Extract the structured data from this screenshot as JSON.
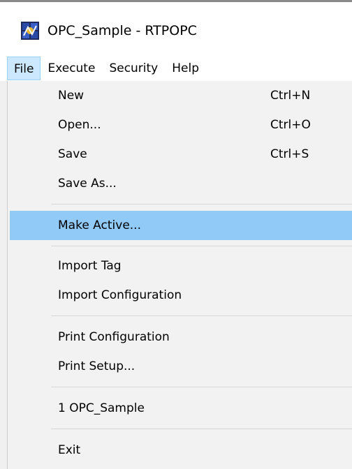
{
  "window": {
    "title": "OPC_Sample - RTPOPC",
    "icon": "rtpopc-app-icon"
  },
  "menu_bar": [
    {
      "label": "File",
      "open": true
    },
    {
      "label": "Execute",
      "open": false
    },
    {
      "label": "Security",
      "open": false
    },
    {
      "label": "Help",
      "open": false
    }
  ],
  "file_menu": {
    "new": {
      "label": "New",
      "shortcut": "Ctrl+N"
    },
    "open": {
      "label": "Open...",
      "shortcut": "Ctrl+O"
    },
    "save": {
      "label": "Save",
      "shortcut": "Ctrl+S"
    },
    "save_as": {
      "label": "Save As..."
    },
    "make_active": {
      "label": "Make Active...",
      "highlighted": true
    },
    "import_tag": {
      "label": "Import Tag"
    },
    "import_configuration": {
      "label": "Import Configuration"
    },
    "print_configuration": {
      "label": "Print Configuration"
    },
    "print_setup": {
      "label": "Print Setup..."
    },
    "recent_file_1": {
      "label": "1 OPC_Sample"
    },
    "exit": {
      "label": "Exit"
    }
  },
  "colors": {
    "highlight": "#91c9f7",
    "menu_open": "#cce8ff",
    "menu_background": "#f2f2f2"
  }
}
